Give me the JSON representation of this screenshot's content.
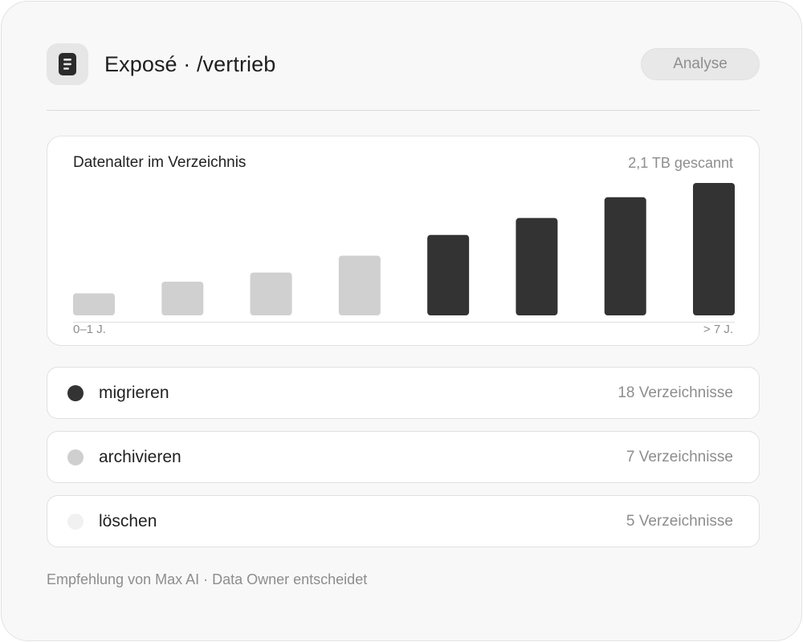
{
  "header": {
    "title": "Exposé · /vertrieb",
    "icon": "document-icon",
    "action_label": "Analyse"
  },
  "chart_panel": {
    "title": "Datenalter im Verzeichnis",
    "meta": "2,1 TB gescannt"
  },
  "chart_data": {
    "type": "bar",
    "title": "Datenalter im Verzeichnis",
    "subtitle": "2,1 TB gescannt",
    "x_start_label": "0–1 J.",
    "x_end_label": "> 7 J.",
    "values": [
      17,
      26,
      33,
      46,
      62,
      75,
      91,
      102
    ],
    "ylim": [
      0,
      102
    ],
    "grid": false,
    "colors": [
      "#d0d0d0",
      "#d0d0d0",
      "#d0d0d0",
      "#d0d0d0",
      "#333333",
      "#333333",
      "#333333",
      "#333333"
    ]
  },
  "actions": [
    {
      "label": "migrieren",
      "count": "18 Verzeichnisse",
      "dot_color": "#333333"
    },
    {
      "label": "archivieren",
      "count": "7 Verzeichnisse",
      "dot_color": "#cfcfcf"
    },
    {
      "label": "löschen",
      "count": "5 Verzeichnisse",
      "dot_color": "#f1f1f1"
    }
  ],
  "footer": {
    "note": "Empfehlung von Max AI · Data Owner entscheidet"
  }
}
